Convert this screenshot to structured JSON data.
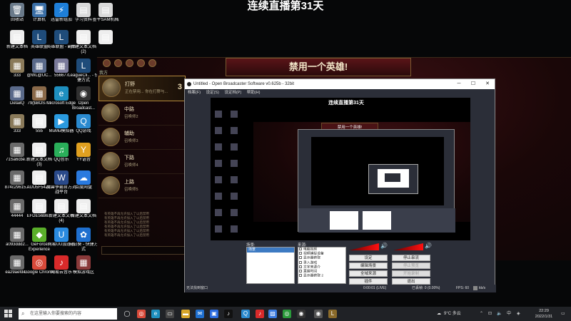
{
  "stream_title": "连续直播第31天",
  "desktop": {
    "icons": [
      {
        "label": "回收站",
        "glyph": "🗑",
        "color": "#6a7a8a"
      },
      {
        "label": "计算机",
        "glyph": "🖥",
        "color": "#3a6ea5"
      },
      {
        "label": "迅雷新组加",
        "glyph": "⚡",
        "color": "#1e7fd9"
      },
      {
        "label": "学习资料",
        "glyph": "▤",
        "color": "#d9d9d9"
      },
      {
        "label": "查平SAM机械",
        "glyph": "▤",
        "color": "#d9d9d9"
      },
      {
        "label": "新建文本档",
        "glyph": "▤",
        "color": "#eeeeee"
      },
      {
        "label": "英雄联盟",
        "glyph": "L",
        "color": "#1f4c7a"
      },
      {
        "label": "英雄联盟 - 副本",
        "glyph": "L",
        "color": "#1f4c7a"
      },
      {
        "label": "新建文本文档 (2)",
        "glyph": "▤",
        "color": "#eeeeee"
      },
      {
        "label": "",
        "glyph": "▤",
        "color": "#eeeeee"
      },
      {
        "label": "333",
        "glyph": "▦",
        "color": "#8a7a5a"
      },
      {
        "label": "@WL@UC...",
        "glyph": "▦",
        "color": "#5a6a8a"
      },
      {
        "label": "556677",
        "glyph": "▦",
        "color": "#7a7a9a"
      },
      {
        "label": "LeagueCli... - 快捷方式",
        "glyph": "L",
        "color": "#1f4c7a"
      },
      {
        "label": "DetailQ",
        "glyph": "▦",
        "color": "#5a6a8a"
      },
      {
        "label": "79($BOS7...",
        "glyph": "▦",
        "color": "#8a6a4a"
      },
      {
        "label": "Microsoft Edge",
        "glyph": "e",
        "color": "#1e8fbf"
      },
      {
        "label": "Open Broadcast...",
        "glyph": "◉",
        "color": "#303030"
      },
      {
        "label": "333",
        "glyph": "▦",
        "color": "#8a7a5a"
      },
      {
        "label": "555",
        "glyph": "▤",
        "color": "#eeeeee"
      },
      {
        "label": "MuMu模拟器",
        "glyph": "▶",
        "color": "#2a9adf"
      },
      {
        "label": "QQ游戏",
        "glyph": "Q",
        "color": "#2a8acf"
      },
      {
        "label": "71Sa6cbe...",
        "glyph": "▦",
        "color": "#6a6a6a"
      },
      {
        "label": "新建文本文档 (3)",
        "glyph": "▤",
        "color": "#eeeeee"
      },
      {
        "label": "QQ音乐",
        "glyph": "♫",
        "color": "#2aaf5a"
      },
      {
        "label": "YY语音",
        "glyph": "Y",
        "color": "#e0a020"
      },
      {
        "label": "874c29615...",
        "glyph": "▦",
        "color": "#6a6a6a"
      },
      {
        "label": "AUU5F54Z...",
        "glyph": "▤",
        "color": "#eeeeee"
      },
      {
        "label": "魔兽争霸官方对战平台",
        "glyph": "W",
        "color": "#2a4a8a"
      },
      {
        "label": "百度网盘",
        "glyph": "☁",
        "color": "#2a7adf"
      },
      {
        "label": "44444",
        "glyph": "▦",
        "color": "#6a6a6a"
      },
      {
        "label": "EFDE56B6...",
        "glyph": "▤",
        "color": "#eeeeee"
      },
      {
        "label": "新建文本文档 (4)",
        "glyph": "▤",
        "color": "#eeeeee"
      },
      {
        "label": "新建文本文档",
        "glyph": "▤",
        "color": "#eeeeee"
      },
      {
        "label": "a093ddd2...",
        "glyph": "▦",
        "color": "#6a6a6a"
      },
      {
        "label": "GeForce Experience",
        "glyph": "◆",
        "color": "#5aaf2a"
      },
      {
        "label": "网易UU加速器",
        "glyph": "U",
        "color": "#2a8adf"
      },
      {
        "label": "向日葵 - 快捷方式",
        "glyph": "✿",
        "color": "#1e6fcf"
      },
      {
        "label": "ea29aefde...",
        "glyph": "▦",
        "color": "#6a6a6a"
      },
      {
        "label": "Google Chrome",
        "glyph": "◎",
        "color": "#d94a3a"
      },
      {
        "label": "网易云音乐",
        "glyph": "♪",
        "color": "#d92a2a"
      },
      {
        "label": "模拟游戏区",
        "glyph": "▦",
        "color": "#8a3a3a"
      }
    ]
  },
  "game": {
    "banner": "禁用一个英雄!",
    "countdown": "3",
    "team_header": "我方",
    "slots": [
      {
        "role": "打野",
        "name": "正在禁用... 你在打野与...",
        "active": true,
        "countdown": "3"
      },
      {
        "role": "中路",
        "name": "召唤师2",
        "active": false,
        "countdown": ""
      },
      {
        "role": "辅助",
        "name": "召唤师3",
        "active": false,
        "countdown": ""
      },
      {
        "role": "下路",
        "name": "召唤师4",
        "active": false,
        "countdown": ""
      },
      {
        "role": "上路",
        "name": "召唤师5",
        "active": false,
        "countdown": ""
      }
    ],
    "chat_lines": [
      "有英雄不再允许加入了以后禁用",
      "有英雄不再允许加入了以后禁用",
      "有英雄不再允许加入了以后禁用",
      "有英雄不再允许加入了以后禁用",
      "有英雄不再允许加入了以后禁用",
      "有英雄不再允许加入了以后禁用"
    ]
  },
  "obs": {
    "title": "Untitled - Open Broadcaster Software v0.625b - 32bit",
    "menu": [
      "档案(F)",
      "设定(S)",
      "设定档(P)",
      "帮助(H)"
    ],
    "preview_title": "连续直播第31天",
    "nested_banner": "禁用一个英雄!",
    "scenes_label": "场景:",
    "scenes": [
      "场景"
    ],
    "sources_label": "来源:",
    "sources": [
      "电脑视频",
      "视频捕捉设备",
      "显示器获取",
      "录入游戏",
      "文字来源介",
      "直播时间",
      "显示器获取 2"
    ],
    "buttons": {
      "settings": "设定",
      "stop_stream": "停止串流",
      "edit_scene": "编辑场景",
      "stop_preview": "停止预览",
      "global_sources": "全域来源",
      "recording": "开始录制",
      "plugins": "插件",
      "exit": "退出"
    },
    "status": {
      "left": "无法找到窗口",
      "time": "0:00:01 (LIVE)",
      "dropped": "已丢帧: 0 (0.00%)",
      "fps": "FPS: 60",
      "kbps": "kb/s"
    }
  },
  "taskbar": {
    "search_placeholder": "在这里输入你要搜索的内容",
    "weather": "9°C 多云",
    "ime": "中",
    "time": "22:29",
    "date": "2022/1/31"
  }
}
